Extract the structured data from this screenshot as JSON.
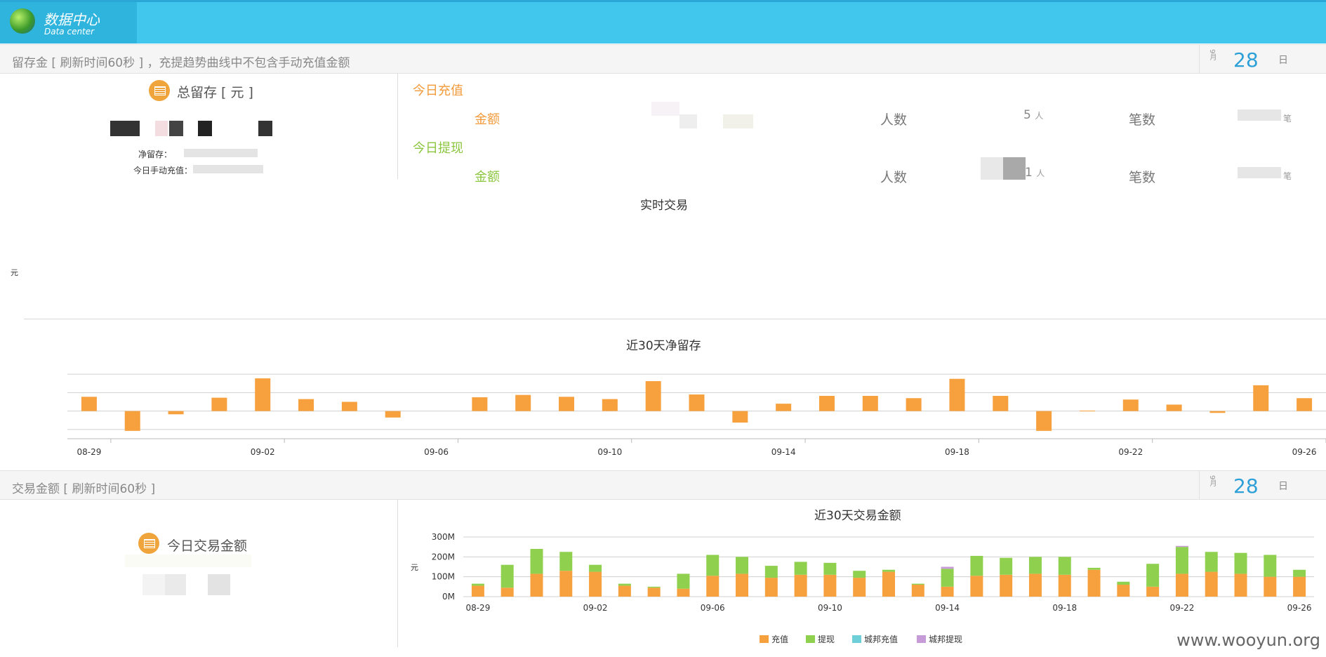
{
  "header": {
    "logo_cn": "数据中心",
    "logo_en": "Data center"
  },
  "section1": {
    "title": "留存金 [ 刷新时间60秒 ] ，充提趋势曲线中不包含手动充值金额",
    "date": {
      "month": "9月",
      "day": "28",
      "unit": "日"
    },
    "total_retention": {
      "title": "总留存 [ 元 ]",
      "net_label": "净留存：",
      "manual_label": "今日手动充值："
    },
    "today_recharge": {
      "heading": "今日充值",
      "amount_label": "金额",
      "people_label": "人数",
      "people_value": "5",
      "people_unit": "人",
      "count_label": "笔数",
      "count_unit": "笔"
    },
    "today_withdraw": {
      "heading": "今日提现",
      "amount_label": "金额",
      "people_label": "人数",
      "people_value": "1",
      "people_unit": "人",
      "count_label": "笔数",
      "count_unit": "笔"
    },
    "realtime": {
      "title": "实时交易",
      "ylabel": "元"
    }
  },
  "section2": {
    "title": "交易金额 [ 刷新时间60秒 ]",
    "date": {
      "month": "9月",
      "day": "28",
      "unit": "日"
    },
    "today_amount_title": "今日交易金额"
  },
  "colors": {
    "recharge": "#f7a13e",
    "withdraw": "#8fd14f",
    "cb_recharge": "#6fcfd8",
    "cb_withdraw": "#c79ad8",
    "accent": "#41c7ee"
  },
  "chart_data": [
    {
      "type": "bar",
      "title": "近30天净留存",
      "x": [
        "08-29",
        "08-30",
        "08-31",
        "09-01",
        "09-02",
        "09-03",
        "09-04",
        "09-05",
        "09-06",
        "09-07",
        "09-08",
        "09-09",
        "09-10",
        "09-11",
        "09-12",
        "09-13",
        "09-14",
        "09-15",
        "09-16",
        "09-17",
        "09-18",
        "09-19",
        "09-20",
        "09-21",
        "09-22",
        "09-23",
        "09-24",
        "09-25",
        "09-26"
      ],
      "xticks": [
        "08-29",
        "09-02",
        "09-06",
        "09-10",
        "09-14",
        "09-18",
        "09-22",
        "09-26"
      ],
      "values": [
        3.1,
        -4.3,
        -0.7,
        2.9,
        7.1,
        2.6,
        2.0,
        -1.4,
        0,
        3.0,
        3.5,
        3.1,
        2.6,
        6.5,
        3.6,
        -2.5,
        1.6,
        3.3,
        3.3,
        2.8,
        7.0,
        3.3,
        -4.3,
        0.1,
        2.5,
        1.4,
        -0.4,
        5.6,
        2.8
      ],
      "ylim": [
        -6,
        10
      ]
    },
    {
      "type": "bar",
      "title": "近30天交易金额",
      "ylabel": "元",
      "yticks": [
        "0M",
        "100M",
        "200M",
        "300M"
      ],
      "ylim": [
        0,
        300
      ],
      "x": [
        "08-29",
        "08-30",
        "08-31",
        "09-01",
        "09-02",
        "09-03",
        "09-04",
        "09-05",
        "09-06",
        "09-07",
        "09-08",
        "09-09",
        "09-10",
        "09-11",
        "09-12",
        "09-13",
        "09-14",
        "09-15",
        "09-16",
        "09-17",
        "09-18",
        "09-19",
        "09-20",
        "09-21",
        "09-22",
        "09-23",
        "09-24",
        "09-25",
        "09-26"
      ],
      "xticks": [
        "08-29",
        "09-02",
        "09-06",
        "09-10",
        "09-14",
        "09-18",
        "09-22",
        "09-26"
      ],
      "series": [
        {
          "name": "充值",
          "color": "#f7a13e",
          "values": [
            55,
            45,
            115,
            130,
            125,
            55,
            45,
            40,
            105,
            115,
            95,
            110,
            110,
            95,
            125,
            60,
            50,
            105,
            110,
            115,
            110,
            135,
            60,
            50,
            115,
            125,
            115,
            100,
            100
          ]
        },
        {
          "name": "提现",
          "color": "#8fd14f",
          "values": [
            10,
            115,
            125,
            95,
            35,
            10,
            5,
            75,
            105,
            85,
            60,
            65,
            60,
            35,
            10,
            5,
            90,
            100,
            85,
            85,
            90,
            10,
            15,
            115,
            135,
            100,
            105,
            110,
            35
          ]
        },
        {
          "name": "城邦充值",
          "color": "#6fcfd8",
          "values": [
            0,
            0,
            0,
            0,
            0,
            0,
            0,
            0,
            0,
            0,
            0,
            0,
            0,
            0,
            0,
            0,
            0,
            0,
            0,
            0,
            0,
            0,
            0,
            0,
            0,
            0,
            0,
            0,
            0
          ]
        },
        {
          "name": "城邦提现",
          "color": "#c79ad8",
          "values": [
            0,
            0,
            0,
            0,
            0,
            0,
            0,
            0,
            0,
            0,
            0,
            0,
            0,
            0,
            0,
            0,
            10,
            0,
            0,
            0,
            0,
            0,
            0,
            0,
            5,
            0,
            0,
            0,
            0
          ]
        }
      ],
      "stacked": true,
      "legend": "bottom-center"
    }
  ],
  "watermark": "www.wooyun.org"
}
